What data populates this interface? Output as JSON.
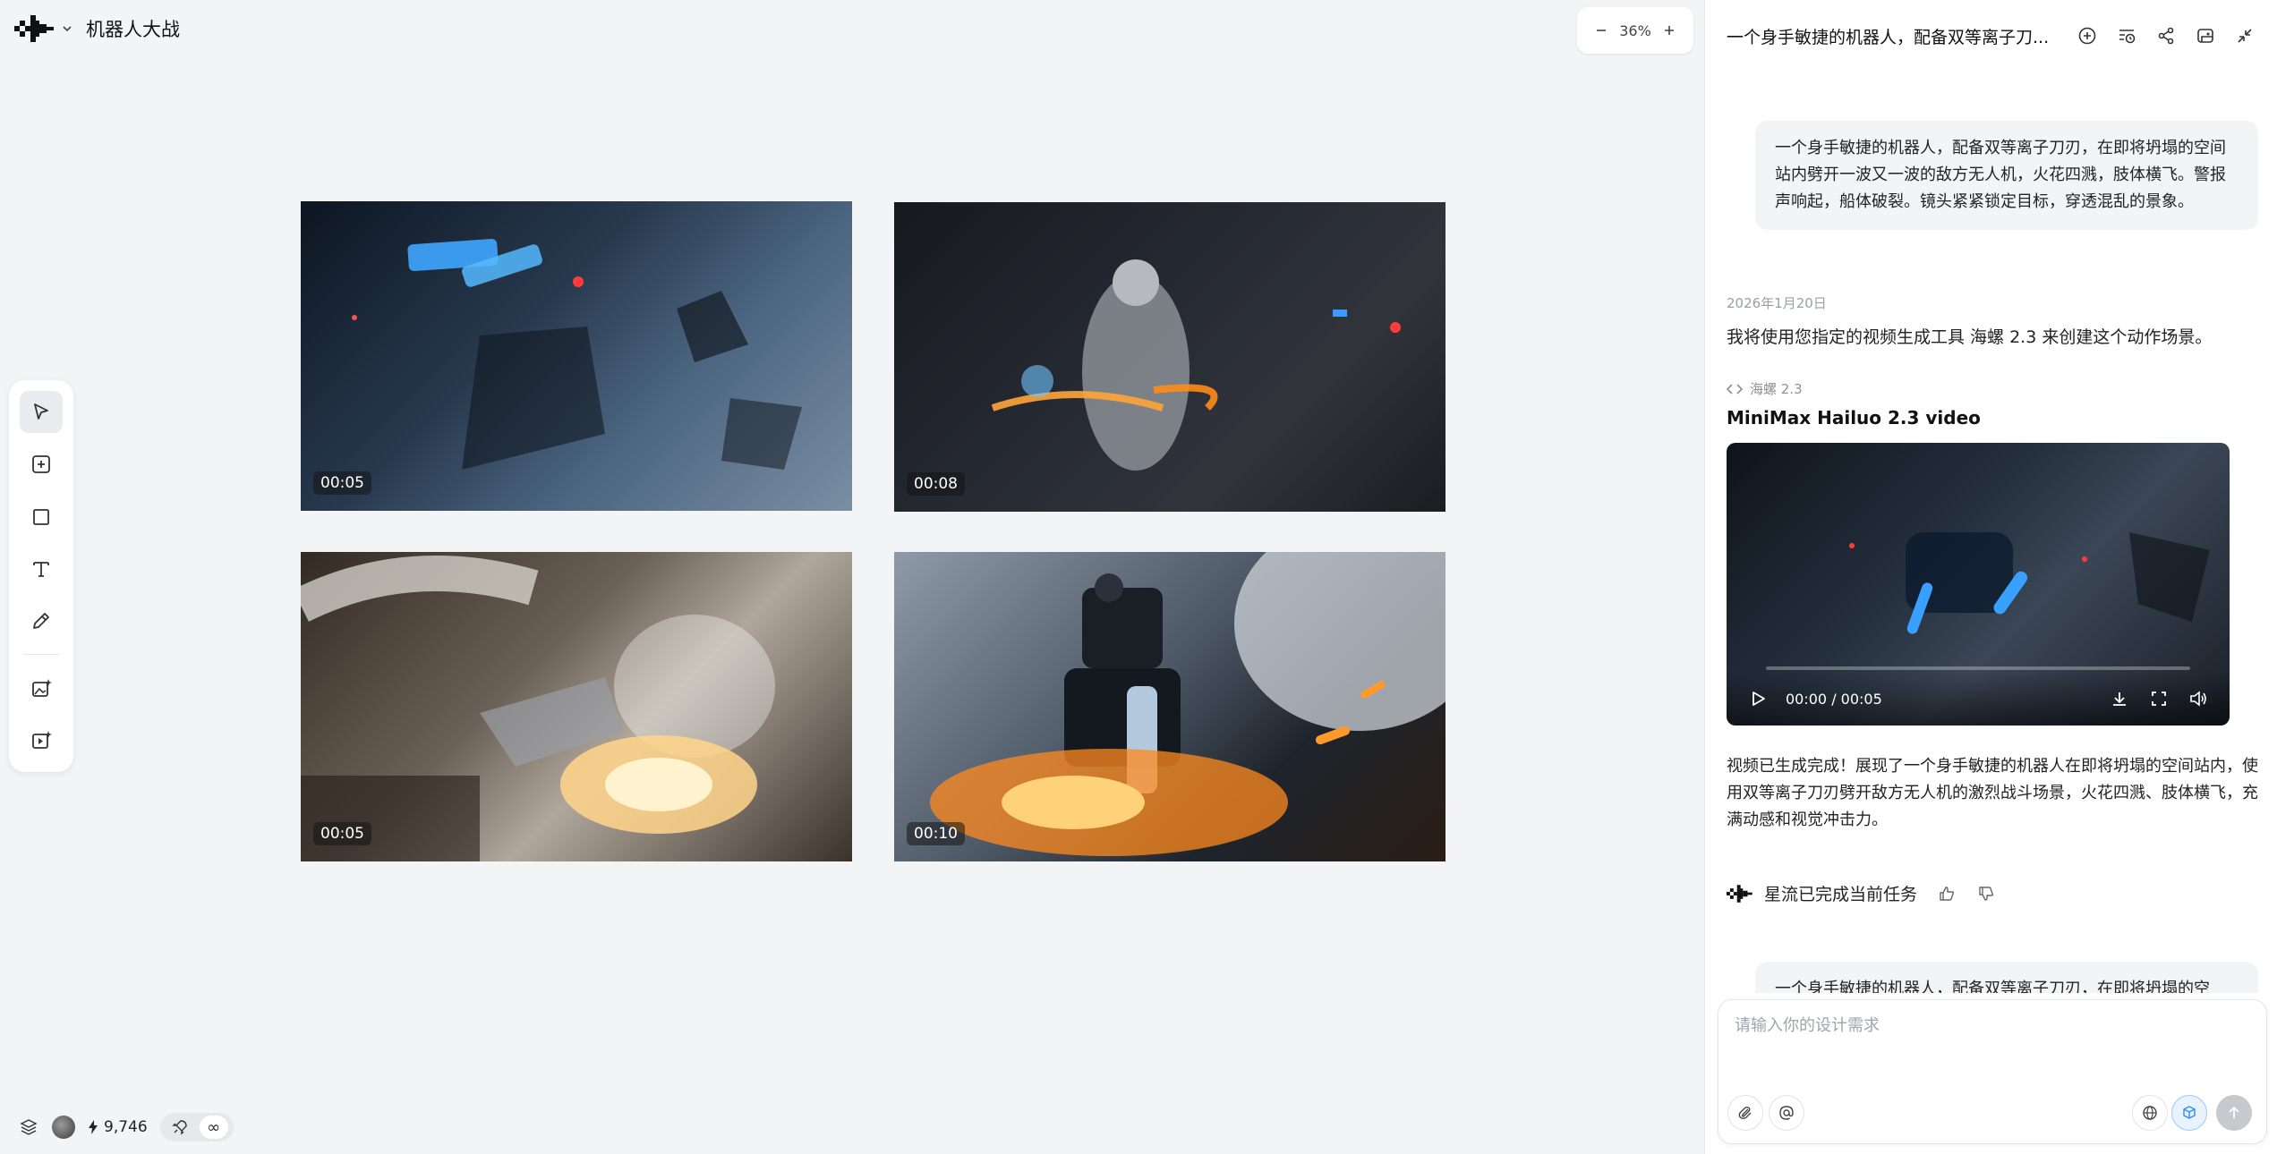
{
  "header": {
    "project_title": "机器人大战"
  },
  "zoom": {
    "value": "36%"
  },
  "toolbar": {
    "tools": [
      "select",
      "add-frame",
      "rectangle",
      "text",
      "pen",
      "image-generate",
      "video-generate"
    ]
  },
  "videos": [
    {
      "duration": "00:05"
    },
    {
      "duration": "00:08"
    },
    {
      "duration": "00:05"
    },
    {
      "duration": "00:10"
    }
  ],
  "status": {
    "credits": "9,746",
    "infinity": "∞"
  },
  "chat": {
    "title": "一个身手敏捷的机器人，配备双等离子刀...",
    "user_prompt": "一个身手敏捷的机器人，配备双等离子刀刃，在即将坍塌的空间站内劈开一波又一波的敌方无人机，火花四溅，肢体横飞。警报声响起，船体破裂。镜头紧紧锁定目标，穿透混乱的景象。",
    "date": "2026年1月20日",
    "assistant_intro": "我将使用您指定的视频生成工具 海螺 2.3 来创建这个动作场景。",
    "tool_tag": "海螺 2.3",
    "model_name": "MiniMax Hailuo 2.3 video",
    "player_time": "00:00 / 00:05",
    "player_progress": 0,
    "result_text": "视频已生成完成！展现了一个身手敏捷的机器人在即将坍塌的空间站内，使用双等离子刀刃劈开敌方无人机的激烈战斗场景，火花四溅、肢体横飞，充满动感和视觉冲击力。",
    "done_text": "星流已完成当前任务",
    "user_prompt_2": "一个身手敏捷的机器人，配备双等离子刀刃，在即将坍塌的空",
    "composer_placeholder": "请输入你的设计需求"
  },
  "colors": {
    "accent": "#2f8bff",
    "canvas_bg": "#f3f4f6",
    "panel_bg": "#ffffff"
  }
}
